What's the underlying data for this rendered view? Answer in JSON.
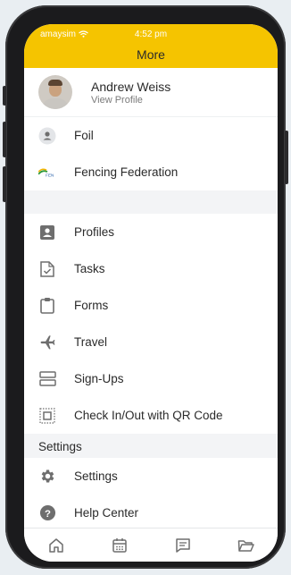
{
  "status": {
    "carrier": "amaysim",
    "time": "4:52 pm"
  },
  "header": {
    "title": "More"
  },
  "profile": {
    "name": "Andrew Weiss",
    "subtitle": "View Profile"
  },
  "accounts": [
    {
      "label": "Foil",
      "icon": "person-icon"
    },
    {
      "label": "Fencing Federation",
      "icon": "federation-logo"
    }
  ],
  "menu": [
    {
      "label": "Profiles",
      "icon": "profile-card-icon"
    },
    {
      "label": "Tasks",
      "icon": "task-document-icon"
    },
    {
      "label": "Forms",
      "icon": "clipboard-icon"
    },
    {
      "label": "Travel",
      "icon": "plane-icon"
    },
    {
      "label": "Sign-Ups",
      "icon": "signup-icon"
    },
    {
      "label": "Check In/Out with QR Code",
      "icon": "qr-code-icon"
    }
  ],
  "settings_section": {
    "title": "Settings",
    "items": [
      {
        "label": "Settings",
        "icon": "gear-icon"
      },
      {
        "label": "Help Center",
        "icon": "help-icon"
      }
    ]
  },
  "tabbar": [
    "home-icon",
    "calendar-icon",
    "chat-icon",
    "folder-icon"
  ],
  "colors": {
    "accent": "#f5c400",
    "icon": "#6e6e6e"
  }
}
